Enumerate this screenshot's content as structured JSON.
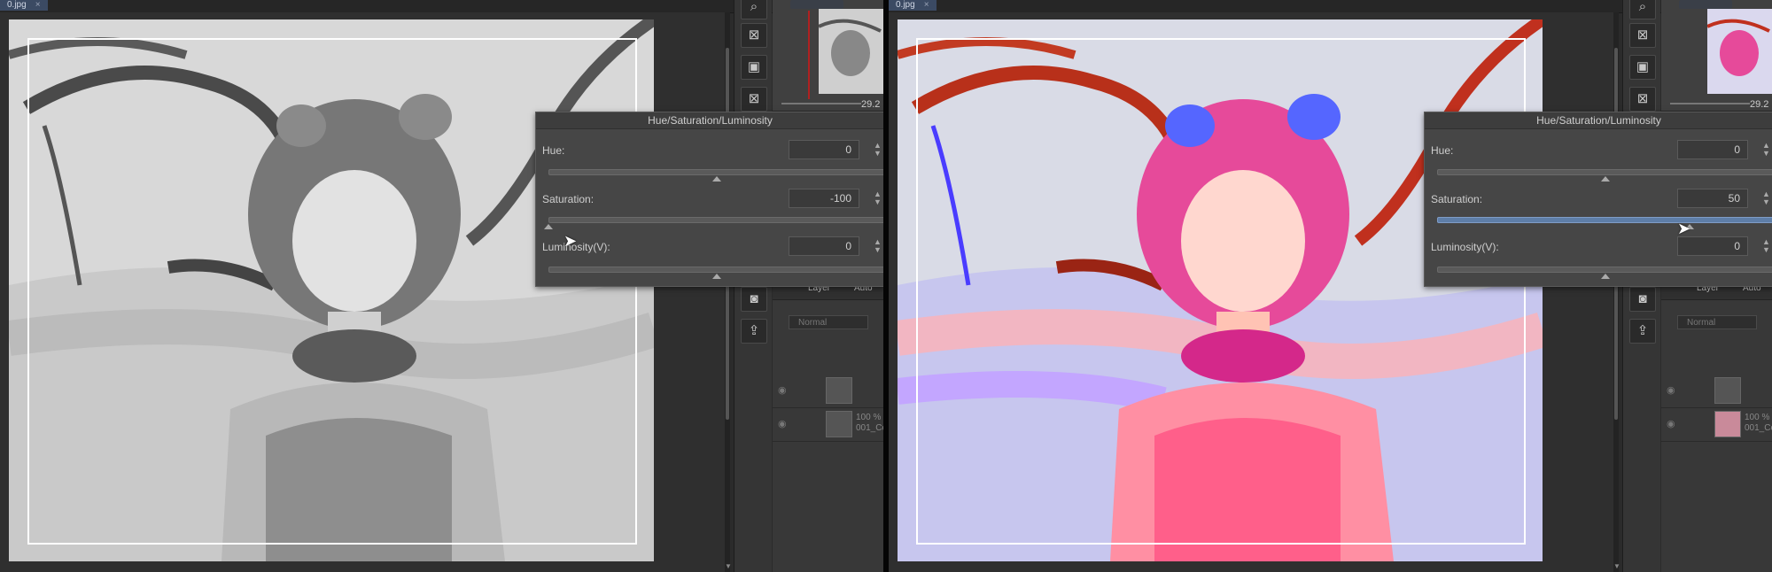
{
  "document": {
    "tab_label": "0.jpg"
  },
  "dialog": {
    "title": "Hue/Saturation/Luminosity",
    "hue_label": "Hue:",
    "saturation_label": "Saturation:",
    "luminosity_label": "Luminosity(V):"
  },
  "left": {
    "hue": "0",
    "saturation": "-100",
    "luminosity": "0",
    "saturation_fraction": 0.0
  },
  "right": {
    "hue": "0",
    "saturation": "50",
    "luminosity": "0",
    "saturation_fraction": 0.75
  },
  "navigator": {
    "zoom": "29.2"
  },
  "layer_panel": {
    "tab_layer": "Layer",
    "tab_auto": "Auto",
    "blend_mode": "Normal",
    "layer1_text": "",
    "layer2_line1": "100 %",
    "layer2_line2": "001_Co"
  },
  "icons": [
    "magnify-icon",
    "clear-icon",
    "fill-icon",
    "clear-outside-icon",
    "camera-icon",
    "export-icon"
  ],
  "colors": {
    "panel": "#464646",
    "slider_active": "#5e7ea8",
    "doc_tab": "#3b4a63"
  }
}
